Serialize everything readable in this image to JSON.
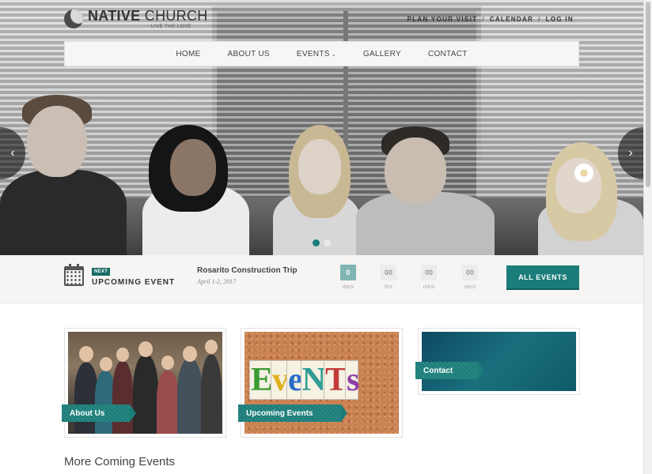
{
  "header": {
    "logo_name_bold": "NATIVE",
    "logo_name_rest": " CHURCH",
    "logo_tagline": "LIVE THE LOVE",
    "top_links": [
      "PLAN YOUR VISIT",
      "CALENDAR",
      "LOG IN"
    ],
    "top_link_separator": "/"
  },
  "nav": {
    "items": [
      "HOME",
      "ABOUT US",
      "EVENTS",
      "GALLERY",
      "CONTACT"
    ]
  },
  "slider": {
    "prev_icon": "chevron-left-icon",
    "next_icon": "chevron-right-icon",
    "prev_glyph": "‹",
    "next_glyph": "›",
    "slide_count": 2,
    "active_slide": 1
  },
  "upcoming": {
    "badge": "NEXT",
    "label": "UPCOMING EVENT",
    "event_title": "Rosarito Construction Trip",
    "event_date": "April 1-2, 2017",
    "countdown": [
      {
        "value": "0",
        "unit": "days"
      },
      {
        "value": "00",
        "unit": "hrs"
      },
      {
        "value": "00",
        "unit": "mins"
      },
      {
        "value": "00",
        "unit": "secs"
      }
    ],
    "button": "ALL EVENTS"
  },
  "tiles": {
    "about": "About Us",
    "events": "Upcoming Events",
    "contact": "Contact"
  },
  "section": {
    "title": "More Coming Events"
  },
  "colors": {
    "accent": "#1a7d79",
    "accent_dark": "#0f5e5a",
    "bar_bg": "#f6f5f3"
  }
}
